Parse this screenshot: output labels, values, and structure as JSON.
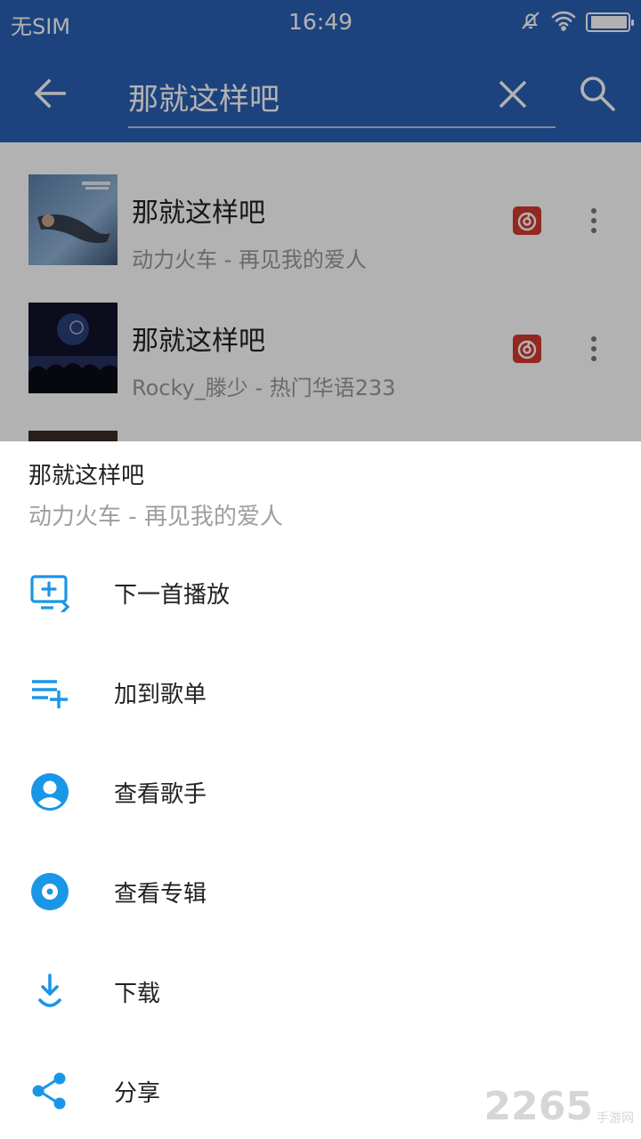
{
  "status_bar": {
    "carrier": "无SIM",
    "time": "16:49",
    "battery_level": 0.95
  },
  "search": {
    "query": "那就这样吧"
  },
  "results": [
    {
      "title": "那就这样吧",
      "subtitle": "动力火车 - 再见我的爱人"
    },
    {
      "title": "那就这样吧",
      "subtitle": "Rocky_滕少 - 热门华语233"
    }
  ],
  "sheet": {
    "title": "那就这样吧",
    "subtitle": "动力火车 - 再见我的爱人",
    "items": [
      {
        "label": "下一首播放",
        "icon": "play-next-icon"
      },
      {
        "label": "加到歌单",
        "icon": "add-to-playlist-icon"
      },
      {
        "label": "查看歌手",
        "icon": "artist-icon"
      },
      {
        "label": "查看专辑",
        "icon": "album-icon"
      },
      {
        "label": "下载",
        "icon": "download-icon"
      },
      {
        "label": "分享",
        "icon": "share-icon"
      }
    ]
  },
  "watermark": {
    "number": "2265",
    "text": "手游网"
  },
  "colors": {
    "primary": "#2a60b5",
    "accent": "#1a96e6",
    "source_badge": "#d33a31"
  }
}
